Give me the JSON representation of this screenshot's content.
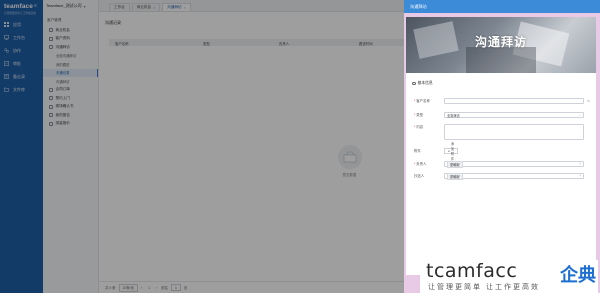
{
  "nav": {
    "logo_text": "teamface",
    "logo_sub": "让管理更简单 让工作更高效",
    "items": [
      {
        "label": "应用",
        "icon": "grid-icon"
      },
      {
        "label": "工作台",
        "icon": "desk-icon"
      },
      {
        "label": "协作",
        "icon": "cooperate-icon"
      },
      {
        "label": "审批",
        "icon": "approval-icon"
      },
      {
        "label": "备忘录",
        "icon": "memo-icon"
      },
      {
        "label": "文件库",
        "icon": "folder-icon"
      }
    ]
  },
  "company": "Teamface_测试公司",
  "side": {
    "section": "客户管理",
    "menu": [
      {
        "label": "商业机会",
        "type": "item"
      },
      {
        "label": "客户资料",
        "type": "item"
      },
      {
        "label": "沟通拜访",
        "type": "item"
      },
      {
        "label": "全部沟通拜访",
        "type": "sub"
      },
      {
        "label": "我的跟进",
        "type": "sub"
      },
      {
        "label": "沟通记录",
        "type": "sub",
        "active": true
      },
      {
        "label": "沟通拜访",
        "type": "sub"
      },
      {
        "label": "合同订单",
        "type": "item"
      },
      {
        "label": "预约上门",
        "type": "item"
      },
      {
        "label": "现场确认书",
        "type": "item"
      },
      {
        "label": "我的报告",
        "type": "item"
      },
      {
        "label": "测量报价",
        "type": "item"
      }
    ]
  },
  "tabs": [
    {
      "label": "工作台"
    },
    {
      "label": "商业机会"
    },
    {
      "label": "沟通拜访",
      "active": true
    }
  ],
  "main": {
    "page_title": "沟通记录",
    "columns": [
      "客户名称",
      "类型",
      "负责人",
      "跟进时间"
    ],
    "empty_text": "暂无数据",
    "pager": {
      "total": "共 0 条",
      "page_size": "20条/页",
      "page": "1",
      "goto_label": "前往",
      "goto_value": "1",
      "page_suffix": "页"
    }
  },
  "drawer": {
    "title": "沟通拜访",
    "banner_title": "沟通拜访",
    "section": "基本信息",
    "fields": [
      {
        "label": "客户名称",
        "required": true,
        "value": ""
      },
      {
        "label": "类型",
        "required": true,
        "value": "业务拜访"
      },
      {
        "label": "内容",
        "required": true,
        "value": ""
      },
      {
        "label": "附件",
        "required": false,
        "value": "添加附件"
      },
      {
        "label": "负责人",
        "required": true,
        "value": "夏曦妮"
      },
      {
        "label": "抄送人",
        "required": false,
        "value": "夏曦妮"
      }
    ]
  },
  "watermark": {
    "brand": "tcamfacc",
    "brand_cn": "企典",
    "slogan": "让管理更简单 让工作更高效"
  },
  "colors": {
    "nav_bg": "#1f5fa8",
    "drawer_head": "#3b8bd8",
    "drawer_frame": "#e8c9e6",
    "accent": "#1e6fd0"
  }
}
